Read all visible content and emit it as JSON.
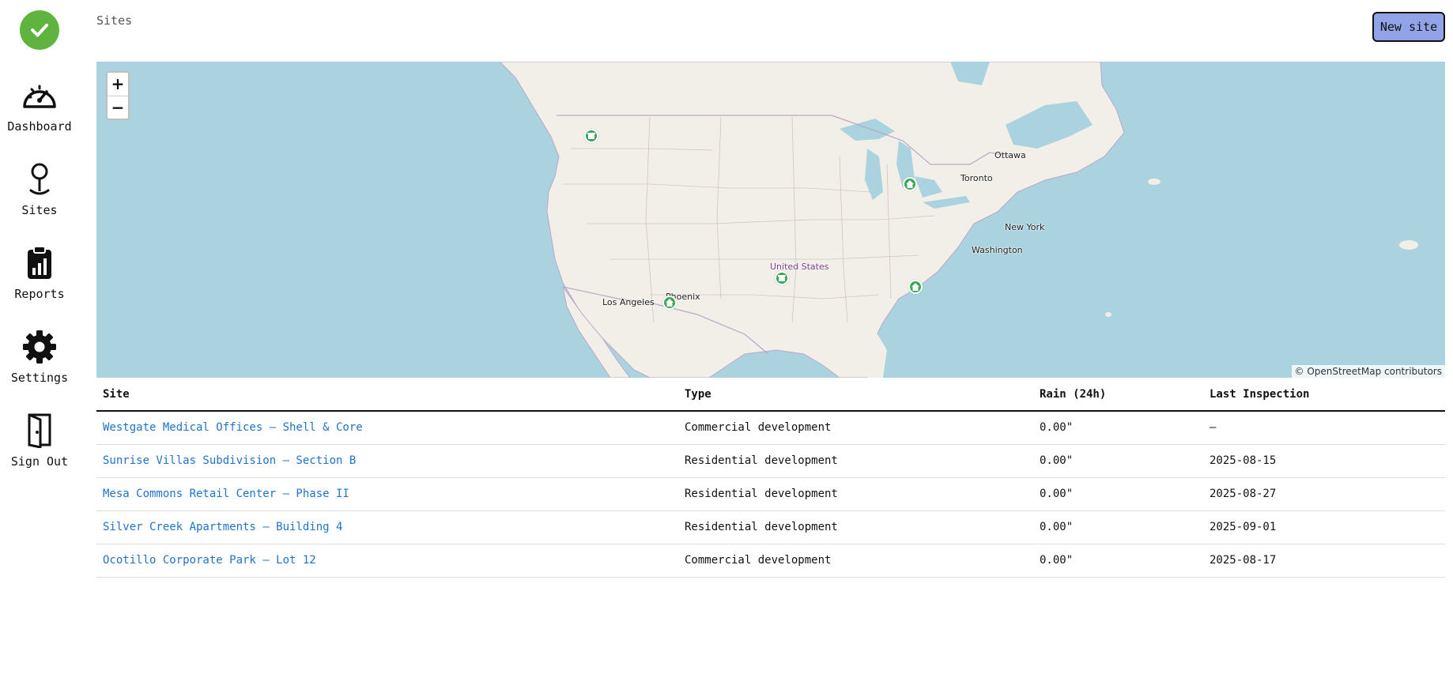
{
  "sidebar": {
    "logo_icon": "check-circle-icon",
    "items": [
      {
        "label": "Dashboard",
        "icon": "speedometer-icon"
      },
      {
        "label": "Sites",
        "icon": "map-pin-icon"
      },
      {
        "label": "Reports",
        "icon": "clipboard-chart-icon"
      },
      {
        "label": "Settings",
        "icon": "gear-icon"
      },
      {
        "label": "Sign Out",
        "icon": "door-icon"
      }
    ]
  },
  "header": {
    "title": "Sites",
    "new_site_label": "New site"
  },
  "map": {
    "zoom_in": "+",
    "zoom_out": "−",
    "attribution": "© OpenStreetMap contributors",
    "labels": {
      "ottawa": "Ottawa",
      "toronto": "Toronto",
      "new_york": "New York",
      "washington": "Washington",
      "united_states": "United States",
      "phoenix": "Phoenix",
      "los_angeles": "Los Angeles"
    }
  },
  "table": {
    "headers": {
      "site": "Site",
      "type": "Type",
      "rain": "Rain (24h)",
      "last_inspection": "Last Inspection"
    },
    "rows": [
      {
        "site": "Westgate Medical Offices – Shell & Core",
        "type": "Commercial development",
        "rain": "0.00\"",
        "last_inspection": "—"
      },
      {
        "site": "Sunrise Villas Subdivision – Section B",
        "type": "Residential development",
        "rain": "0.00\"",
        "last_inspection": "2025-08-15"
      },
      {
        "site": "Mesa Commons Retail Center – Phase II",
        "type": "Residential development",
        "rain": "0.00\"",
        "last_inspection": "2025-08-27"
      },
      {
        "site": "Silver Creek Apartments – Building 4",
        "type": "Residential development",
        "rain": "0.00\"",
        "last_inspection": "2025-09-01"
      },
      {
        "site": "Ocotillo Corporate Park – Lot 12",
        "type": "Commercial development",
        "rain": "0.00\"",
        "last_inspection": "2025-08-17"
      }
    ]
  }
}
